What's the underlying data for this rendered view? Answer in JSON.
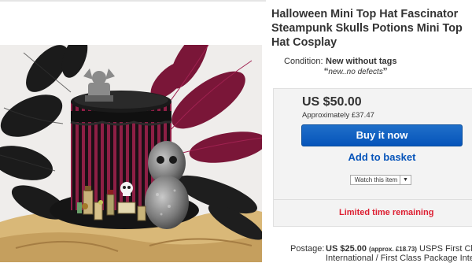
{
  "listing": {
    "title": "Halloween Mini Top Hat Fascinator Steampunk Skulls Potions Mini Top Hat Cosplay",
    "image": {
      "alt": "Mini top hat fascinator with black and burgundy feathers, striped band, skulls, gargoyle and potion bottles"
    }
  },
  "condition": {
    "label": "Condition:",
    "value": "New without tags",
    "note": "new..no defects"
  },
  "buy_box": {
    "price": "US $50.00",
    "approx": "Approximately £37.47",
    "buy_label": "Buy it now",
    "basket_label": "Add to basket",
    "watch_label": "Watch this item",
    "urgency": "Limited time remaining"
  },
  "postage": {
    "label": "Postage:",
    "price": "US $25.00",
    "approx": "(approx. £18.73)",
    "service_line1": "USPS First Class",
    "service_line2": "International / First Class Package Internatio"
  },
  "colors": {
    "buy_button": "#0654ba",
    "link": "#0654ba",
    "urgency": "#dd1e31",
    "buy_box_bg": "#f3f3f3"
  },
  "icons": {
    "quote_open": "“",
    "quote_close": "”",
    "watch_arrow": "▼"
  }
}
